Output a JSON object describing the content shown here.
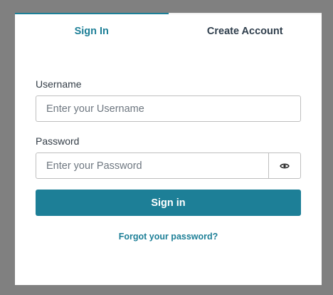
{
  "tabs": {
    "sign_in": "Sign In",
    "create_account": "Create Account"
  },
  "username": {
    "label": "Username",
    "placeholder": "Enter your Username",
    "value": ""
  },
  "password": {
    "label": "Password",
    "placeholder": "Enter your Password",
    "value": "",
    "toggle_icon": "eye-icon"
  },
  "actions": {
    "sign_in_button": "Sign in",
    "forgot_password_link": "Forgot your password?"
  },
  "colors": {
    "accent": "#1d7f97",
    "backdrop": "#808080",
    "card": "#ffffff"
  }
}
